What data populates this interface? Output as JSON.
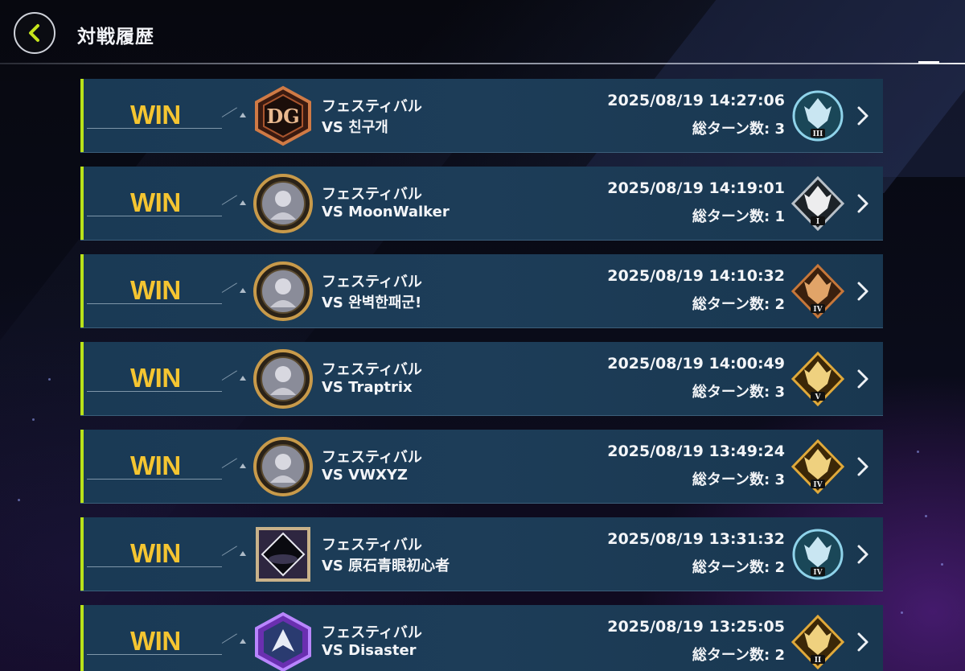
{
  "header": {
    "title": "対戦履歴",
    "back_icon": "chevron-left-icon",
    "accent": "#c5e41c"
  },
  "colors": {
    "win": "#f5c531",
    "row_bg": "#1b3b56",
    "row_accent": "#b9e21a"
  },
  "matches": [
    {
      "result": "WIN",
      "mode": "フェスティバル",
      "opponent": "VS 친구개",
      "datetime": "2025/08/19 14:27:06",
      "turns": "総ターン数: 3",
      "avatar": "dg-emblem-icon",
      "rank_tier": "III",
      "rank": "platinum-rank-icon"
    },
    {
      "result": "WIN",
      "mode": "フェスティバル",
      "opponent": "VS MoonWalker",
      "datetime": "2025/08/19 14:19:01",
      "turns": "総ターン数: 1",
      "avatar": "character-portrait-icon",
      "rank_tier": "I",
      "rank": "silver-rank-icon"
    },
    {
      "result": "WIN",
      "mode": "フェスティバル",
      "opponent": "VS 완벽한패군!",
      "datetime": "2025/08/19 14:10:32",
      "turns": "総ターン数: 2",
      "avatar": "character-portrait-icon",
      "rank_tier": "IV",
      "rank": "bronze-rank-icon"
    },
    {
      "result": "WIN",
      "mode": "フェスティバル",
      "opponent": "VS Traptrix",
      "datetime": "2025/08/19 14:00:49",
      "turns": "総ターン数: 3",
      "avatar": "character-portrait-icon",
      "rank_tier": "V",
      "rank": "gold-rank-icon"
    },
    {
      "result": "WIN",
      "mode": "フェスティバル",
      "opponent": "VS VWXYZ",
      "datetime": "2025/08/19 13:49:24",
      "turns": "総ターン数: 3",
      "avatar": "character-portrait-icon",
      "rank_tier": "IV",
      "rank": "gold-rank-icon"
    },
    {
      "result": "WIN",
      "mode": "フェスティバル",
      "opponent": "VS 原石青眼初心者",
      "datetime": "2025/08/19 13:31:32",
      "turns": "総ターン数: 2",
      "avatar": "dark-orb-icon",
      "rank_tier": "IV",
      "rank": "platinum-rank-icon"
    },
    {
      "result": "WIN",
      "mode": "フェスティバル",
      "opponent": "VS Disaster",
      "datetime": "2025/08/19 13:25:05",
      "turns": "総ターン数: 2",
      "avatar": "dragon-portrait-icon",
      "rank_tier": "II",
      "rank": "gold-rank-icon"
    }
  ]
}
